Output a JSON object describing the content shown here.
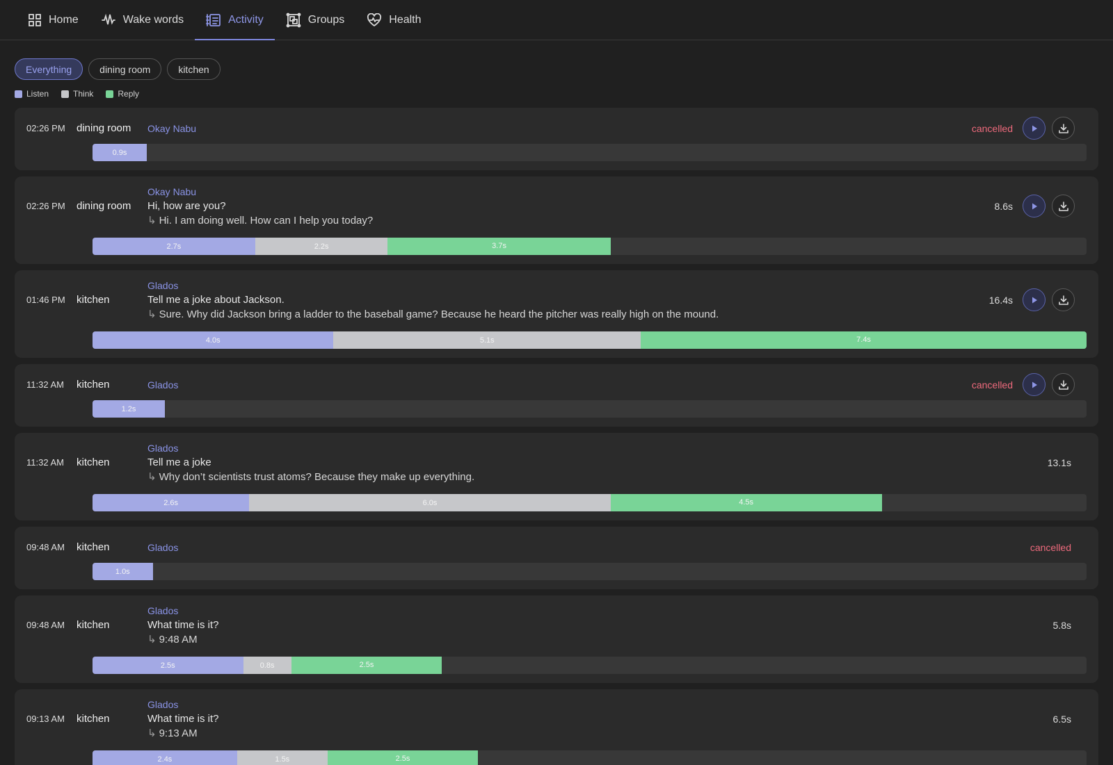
{
  "nav": {
    "items": [
      {
        "label": "Home",
        "icon": "grid-icon",
        "active": false
      },
      {
        "label": "Wake words",
        "icon": "waveform-icon",
        "active": false
      },
      {
        "label": "Activity",
        "icon": "activity-list-icon",
        "active": true
      },
      {
        "label": "Groups",
        "icon": "groups-icon",
        "active": false
      },
      {
        "label": "Health",
        "icon": "heart-pulse-icon",
        "active": false
      }
    ]
  },
  "filters": [
    {
      "label": "Everything",
      "active": true
    },
    {
      "label": "dining room",
      "active": false
    },
    {
      "label": "kitchen",
      "active": false
    }
  ],
  "legend": [
    {
      "label": "Listen",
      "color": "#a3a9e4"
    },
    {
      "label": "Think",
      "color": "#c6c7ca"
    },
    {
      "label": "Reply",
      "color": "#79d497"
    }
  ],
  "activities": [
    {
      "time": "02:26 PM",
      "room": "dining room",
      "wake": "Okay Nabu",
      "utterance": "",
      "reply": "",
      "status": "cancelled",
      "duration": "",
      "buttons": true,
      "segments": [
        {
          "type": "listen",
          "seconds": 0.9,
          "label": "0.9s"
        }
      ]
    },
    {
      "time": "02:26 PM",
      "room": "dining room",
      "wake": "Okay Nabu",
      "utterance": "Hi, how are you?",
      "reply": "Hi. I am doing well. How can I help you today?",
      "status": "",
      "duration": "8.6s",
      "buttons": true,
      "segments": [
        {
          "type": "listen",
          "seconds": 2.7,
          "label": "2.7s"
        },
        {
          "type": "think",
          "seconds": 2.2,
          "label": "2.2s"
        },
        {
          "type": "reply",
          "seconds": 3.7,
          "label": "3.7s"
        }
      ]
    },
    {
      "time": "01:46 PM",
      "room": "kitchen",
      "wake": "Glados",
      "utterance": "Tell me a joke about Jackson.",
      "reply": "Sure. Why did Jackson bring a ladder to the baseball game? Because he heard the pitcher was really high on the mound.",
      "status": "",
      "duration": "16.4s",
      "buttons": true,
      "segments": [
        {
          "type": "listen",
          "seconds": 4.0,
          "label": "4.0s"
        },
        {
          "type": "think",
          "seconds": 5.1,
          "label": "5.1s"
        },
        {
          "type": "reply",
          "seconds": 7.4,
          "label": "7.4s"
        }
      ]
    },
    {
      "time": "11:32 AM",
      "room": "kitchen",
      "wake": "Glados",
      "utterance": "",
      "reply": "",
      "status": "cancelled",
      "duration": "",
      "buttons": true,
      "segments": [
        {
          "type": "listen",
          "seconds": 1.2,
          "label": "1.2s"
        }
      ]
    },
    {
      "time": "11:32 AM",
      "room": "kitchen",
      "wake": "Glados",
      "utterance": "Tell me a joke",
      "reply": "Why don’t scientists trust atoms? Because they make up everything.",
      "status": "",
      "duration": "13.1s",
      "buttons": false,
      "segments": [
        {
          "type": "listen",
          "seconds": 2.6,
          "label": "2.6s"
        },
        {
          "type": "think",
          "seconds": 6.0,
          "label": "6.0s"
        },
        {
          "type": "reply",
          "seconds": 4.5,
          "label": "4.5s"
        }
      ]
    },
    {
      "time": "09:48 AM",
      "room": "kitchen",
      "wake": "Glados",
      "utterance": "",
      "reply": "",
      "status": "cancelled",
      "duration": "",
      "buttons": false,
      "segments": [
        {
          "type": "listen",
          "seconds": 1.0,
          "label": "1.0s"
        }
      ]
    },
    {
      "time": "09:48 AM",
      "room": "kitchen",
      "wake": "Glados",
      "utterance": "What time is it?",
      "reply": "9:48 AM",
      "status": "",
      "duration": "5.8s",
      "buttons": false,
      "segments": [
        {
          "type": "listen",
          "seconds": 2.5,
          "label": "2.5s"
        },
        {
          "type": "think",
          "seconds": 0.8,
          "label": "0.8s"
        },
        {
          "type": "reply",
          "seconds": 2.5,
          "label": "2.5s"
        }
      ]
    },
    {
      "time": "09:13 AM",
      "room": "kitchen",
      "wake": "Glados",
      "utterance": "What time is it?",
      "reply": "9:13 AM",
      "status": "",
      "duration": "6.5s",
      "buttons": false,
      "segments": [
        {
          "type": "listen",
          "seconds": 2.4,
          "label": "2.4s"
        },
        {
          "type": "think",
          "seconds": 1.5,
          "label": "1.5s"
        },
        {
          "type": "reply",
          "seconds": 2.5,
          "label": "2.5s"
        }
      ]
    }
  ],
  "timeline_max_seconds": 16.5
}
